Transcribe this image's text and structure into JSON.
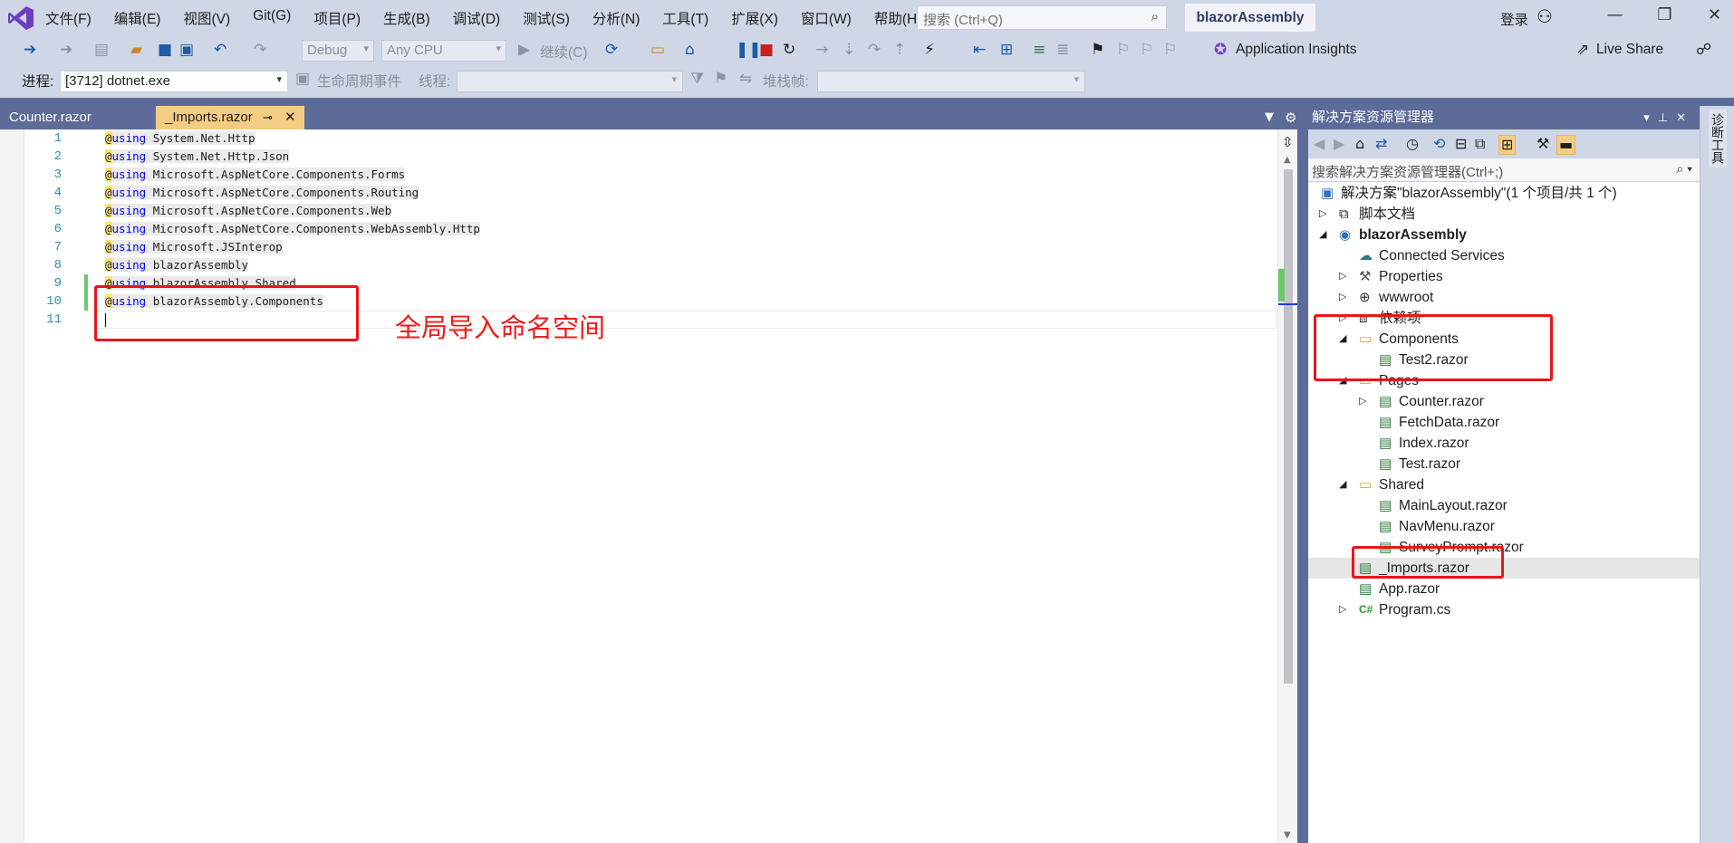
{
  "menubar": {
    "items": [
      "文件(F)",
      "编辑(E)",
      "视图(V)",
      "Git(G)",
      "项目(P)",
      "生成(B)",
      "调试(D)",
      "测试(S)",
      "分析(N)",
      "工具(T)",
      "扩展(X)",
      "窗口(W)",
      "帮助(H)"
    ],
    "search_placeholder": "搜索 (Ctrl+Q)",
    "project_name": "blazorAssembly",
    "login": "登录"
  },
  "toolbar1": {
    "config": "Debug",
    "platform": "Any CPU",
    "continue": "继续(C)",
    "app_insights": "Application Insights",
    "live_share": "Live Share"
  },
  "toolbar2": {
    "process_label": "进程:",
    "process_value": "[3712] dotnet.exe",
    "lifecycle": "生命周期事件",
    "thread_label": "线程:",
    "stack_label": "堆栈帧:"
  },
  "tabs": [
    {
      "label": "Counter.razor",
      "active": false
    },
    {
      "label": "_Imports.razor",
      "active": true
    }
  ],
  "editor": {
    "lines": [
      {
        "num": "1",
        "kw": "using",
        "ns": " System.Net.Http"
      },
      {
        "num": "2",
        "kw": "using",
        "ns": " System.Net.Http.Json"
      },
      {
        "num": "3",
        "kw": "using",
        "ns": " Microsoft.AspNetCore.Components.Forms"
      },
      {
        "num": "4",
        "kw": "using",
        "ns": " Microsoft.AspNetCore.Components.Routing"
      },
      {
        "num": "5",
        "kw": "using",
        "ns": " Microsoft.AspNetCore.Components.Web"
      },
      {
        "num": "6",
        "kw": "using",
        "ns": " Microsoft.AspNetCore.Components.WebAssembly.Http"
      },
      {
        "num": "7",
        "kw": "using",
        "ns": " Microsoft.JSInterop"
      },
      {
        "num": "8",
        "kw": "using",
        "ns": " blazorAssembly"
      },
      {
        "num": "9",
        "kw": "using",
        "ns": " blazorAssembly.Shared"
      },
      {
        "num": "10",
        "kw": "using",
        "ns": " blazorAssembly.Components"
      },
      {
        "num": "11",
        "kw": "",
        "ns": ""
      }
    ],
    "annotation": "全局导入命名空间"
  },
  "solution_explorer": {
    "title": "解决方案资源管理器",
    "search_placeholder": "搜索解决方案资源管理器(Ctrl+;)",
    "nodes": [
      {
        "label": "解决方案\"blazorAssembly\"(1 个项目/共 1 个)",
        "icon": "solution-icon"
      },
      {
        "label": "脚本文档",
        "icon": "script-docs-icon"
      },
      {
        "label": "blazorAssembly",
        "icon": "project-icon"
      },
      {
        "label": "Connected Services",
        "icon": "connected-services-icon"
      },
      {
        "label": "Properties",
        "icon": "wrench-icon"
      },
      {
        "label": "wwwroot",
        "icon": "globe-icon"
      },
      {
        "label": "依赖项",
        "icon": "dependencies-icon"
      },
      {
        "label": "Components",
        "icon": "folder-icon"
      },
      {
        "label": "Test2.razor",
        "icon": "razor-file-icon"
      },
      {
        "label": "Pages",
        "icon": "folder-icon"
      },
      {
        "label": "Counter.razor",
        "icon": "razor-file-icon"
      },
      {
        "label": "FetchData.razor",
        "icon": "razor-file-icon"
      },
      {
        "label": "Index.razor",
        "icon": "razor-file-icon"
      },
      {
        "label": "Test.razor",
        "icon": "razor-file-icon"
      },
      {
        "label": "Shared",
        "icon": "folder-icon"
      },
      {
        "label": "MainLayout.razor",
        "icon": "razor-file-icon"
      },
      {
        "label": "NavMenu.razor",
        "icon": "razor-file-icon"
      },
      {
        "label": "SurveyPrompt.razor",
        "icon": "razor-file-icon"
      },
      {
        "label": "_Imports.razor",
        "icon": "razor-file-icon"
      },
      {
        "label": "App.razor",
        "icon": "razor-file-icon"
      },
      {
        "label": "Program.cs",
        "icon": "csharp-file-icon"
      }
    ]
  },
  "right_rail": {
    "label": "诊断工具"
  },
  "colors": {
    "accent": "#f5cc84",
    "chrome": "#cfd6e5",
    "dock": "#5d6b99",
    "annotation": "#e8151b"
  }
}
